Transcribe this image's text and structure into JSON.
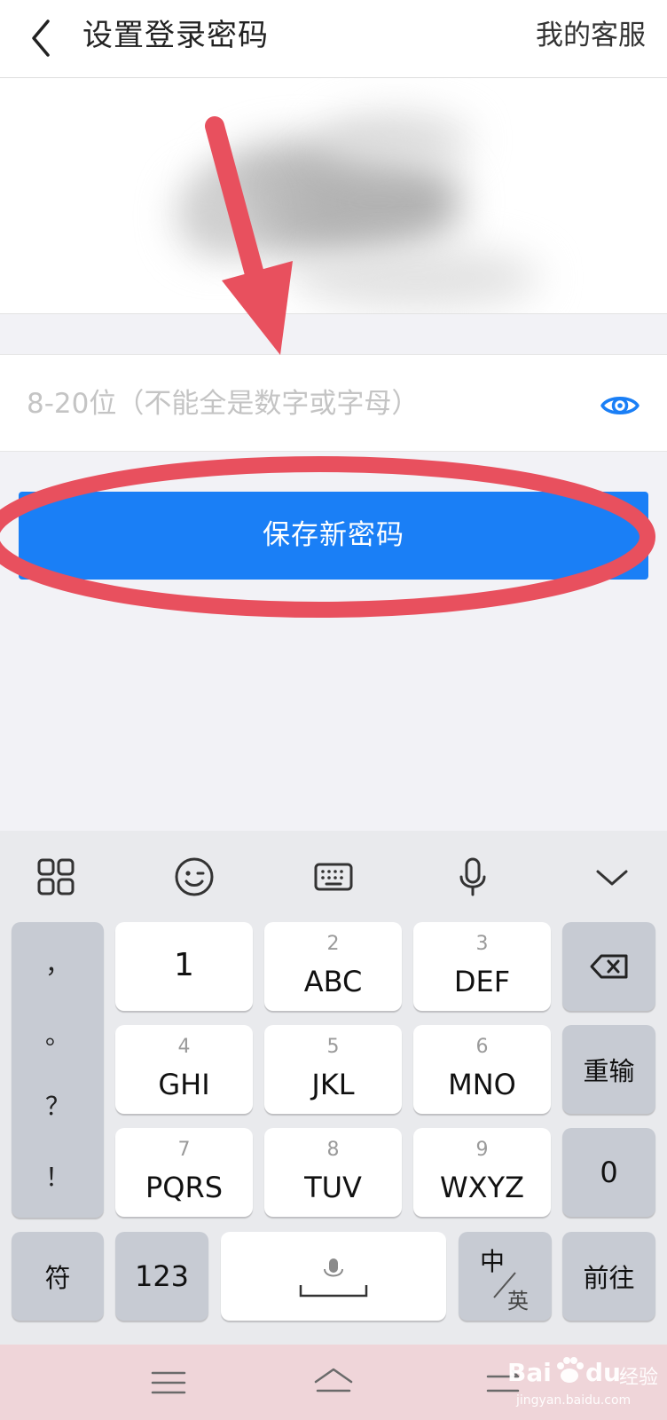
{
  "header": {
    "title": "设置登录密码",
    "service_link": "我的客服"
  },
  "password": {
    "placeholder": "8-20位（不能全是数字或字母）",
    "value": ""
  },
  "save_button_label": "保存新密码",
  "annotation_color": "#e8505e",
  "accent_color": "#1a7ff6",
  "keyboard": {
    "toolbar": [
      "grid-icon",
      "emoji-icon",
      "keyboard-icon",
      "microphone-icon",
      "collapse-icon"
    ],
    "punctuation": [
      "，",
      "。",
      "？",
      "！"
    ],
    "keys": {
      "k1": {
        "main": "1"
      },
      "k2": {
        "num": "2",
        "main": "ABC"
      },
      "k3": {
        "num": "3",
        "main": "DEF"
      },
      "k4": {
        "num": "4",
        "main": "GHI"
      },
      "k5": {
        "num": "5",
        "main": "JKL"
      },
      "k6": {
        "num": "6",
        "main": "MNO"
      },
      "k7": {
        "num": "7",
        "main": "PQRS"
      },
      "k8": {
        "num": "8",
        "main": "TUV"
      },
      "k9": {
        "num": "9",
        "main": "WXYZ"
      },
      "k0": {
        "main": "0"
      }
    },
    "backspace": "backspace-icon",
    "reinput": "重输",
    "symbols": "符",
    "numbers": "123",
    "lang_top": "中",
    "lang_bottom": "英",
    "go": "前往"
  },
  "watermark": {
    "brand": "Bai",
    "brand2": "du",
    "cn": "经验",
    "url": "jingyan.baidu.com"
  }
}
